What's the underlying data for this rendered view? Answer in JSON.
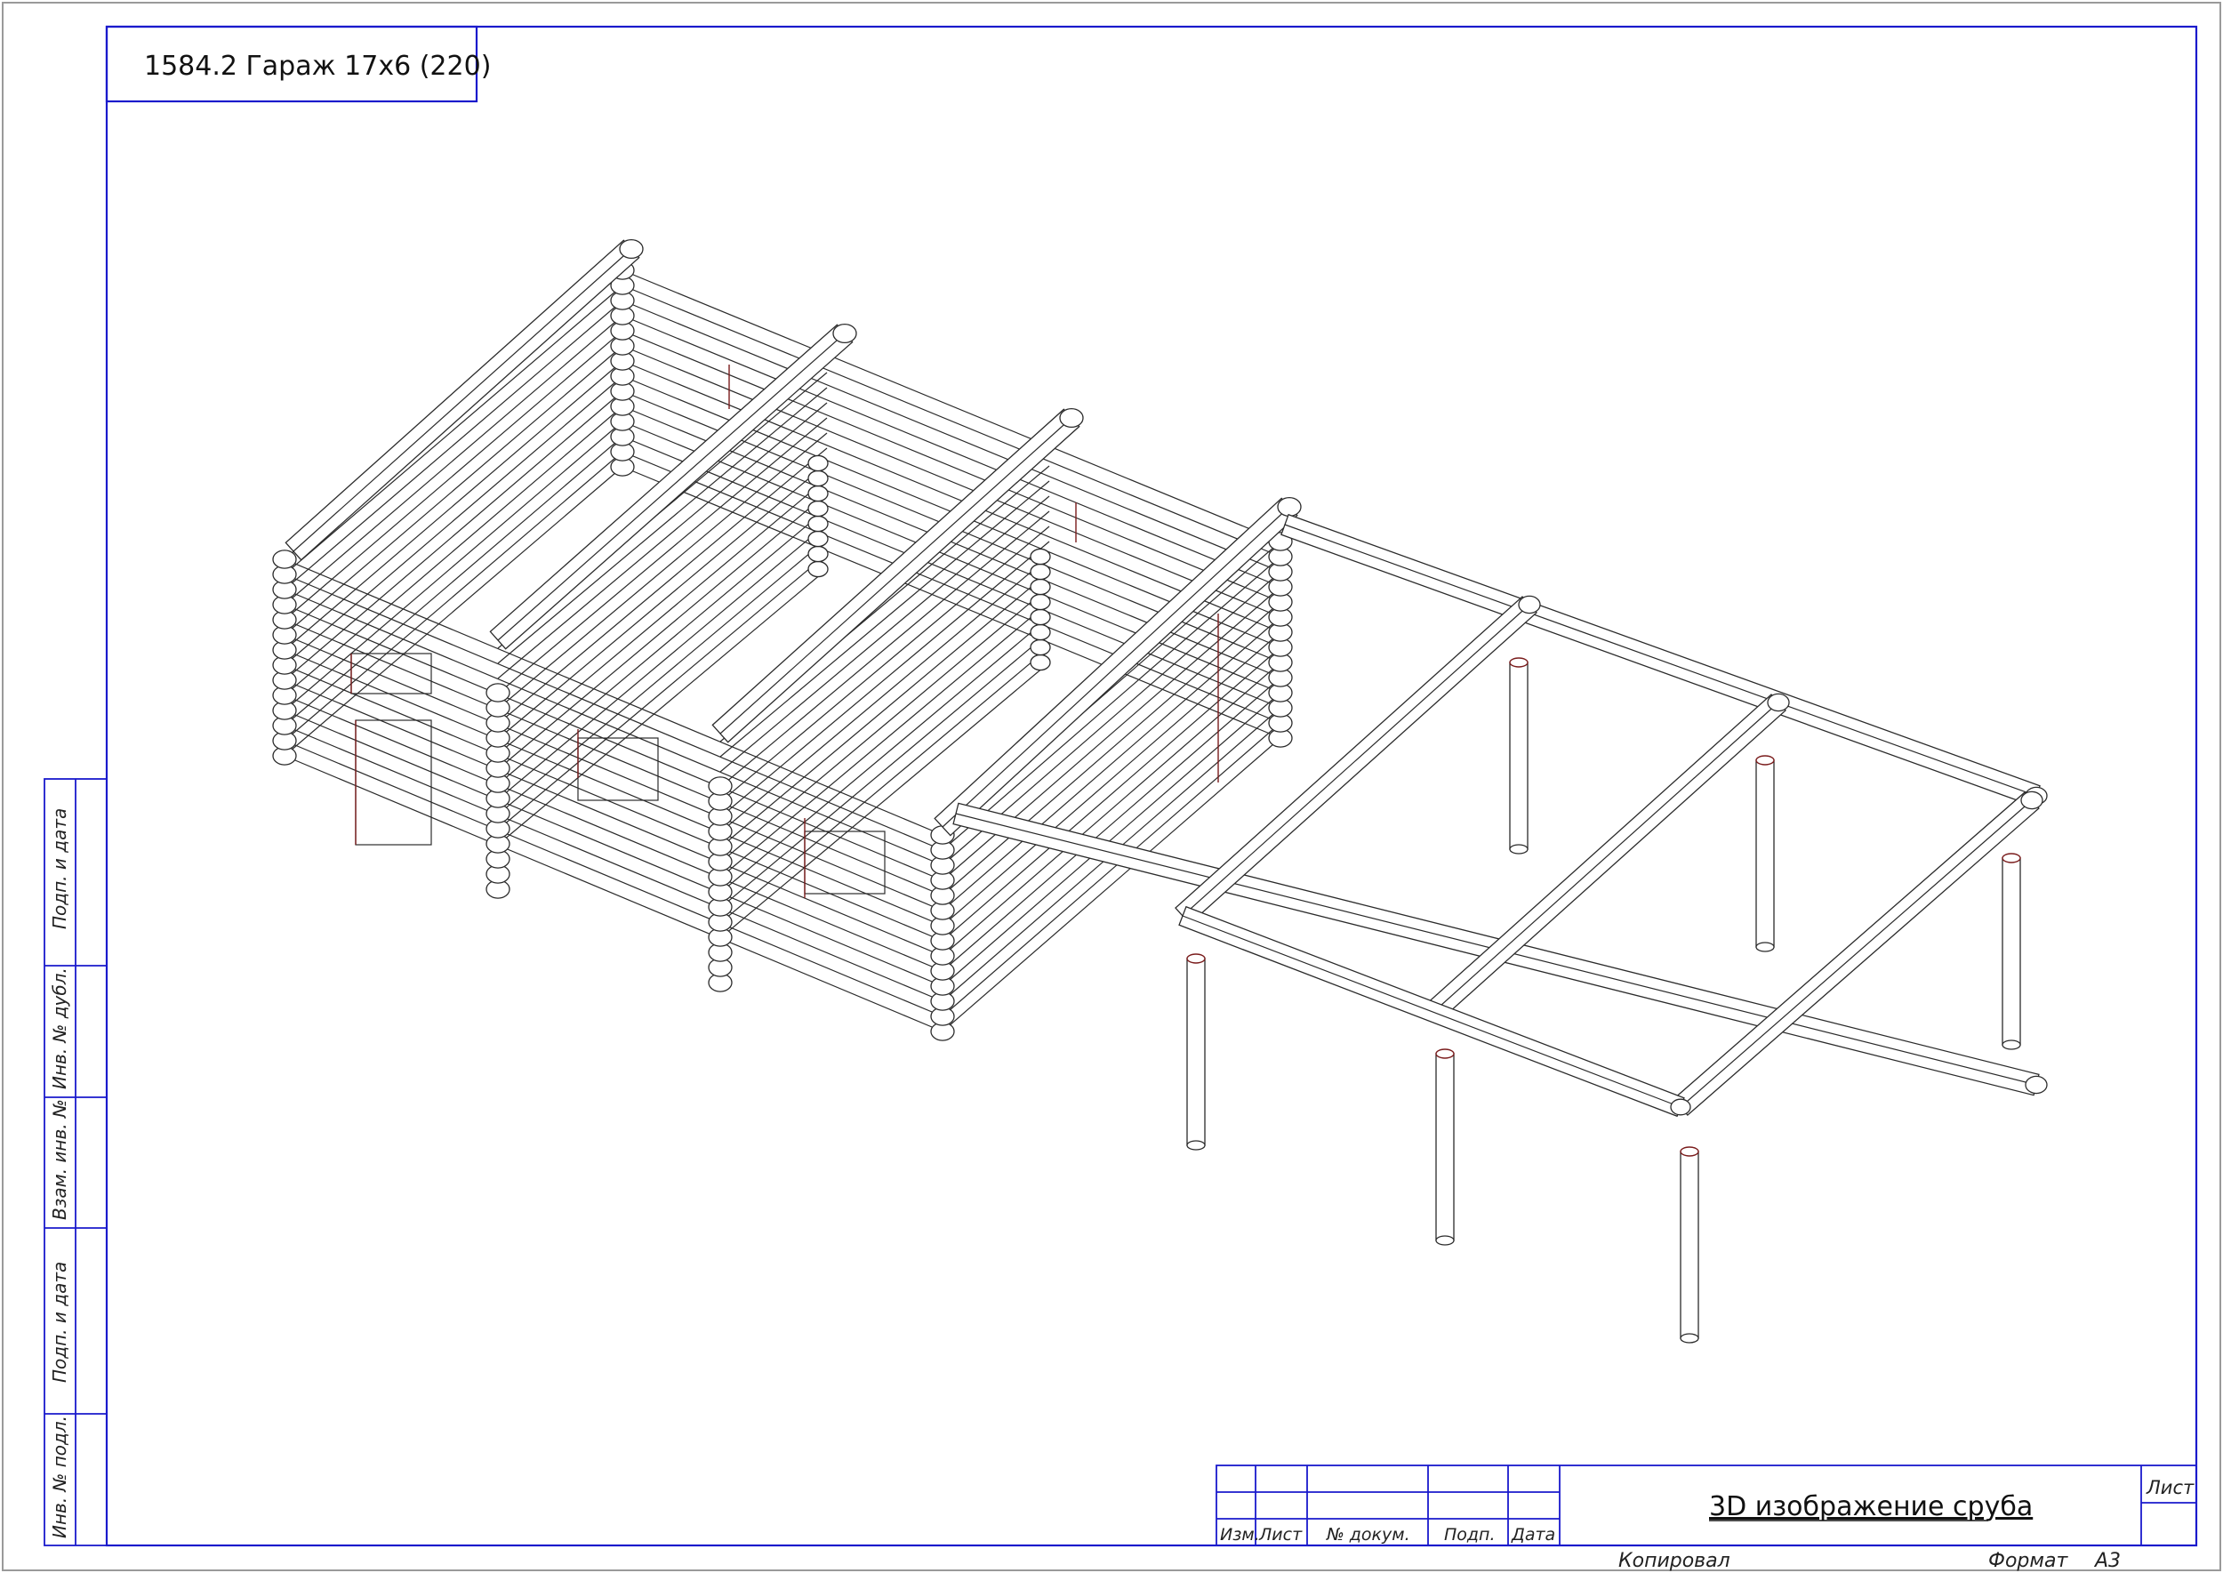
{
  "drawing_title": "1584.2 Гараж 17х6 (220)",
  "sheet_name": "3D изображение сруба",
  "side_stamp": [
    "Инв. № подл.",
    "Подп. и дата",
    "Взам. инв. №",
    "Инв. № дубл.",
    "Подп. и дата"
  ],
  "title_block": {
    "columns": [
      "Изм.",
      "Лист",
      "№ докум.",
      "Подп.",
      "Дата"
    ],
    "sheet_label": "Лист",
    "copied": "Копировал",
    "format_label": "Формат",
    "format_value": "А3"
  },
  "colors": {
    "frame": "#1a1acc",
    "lines": "#2b2b2b",
    "seams": "#7a1c1c"
  }
}
